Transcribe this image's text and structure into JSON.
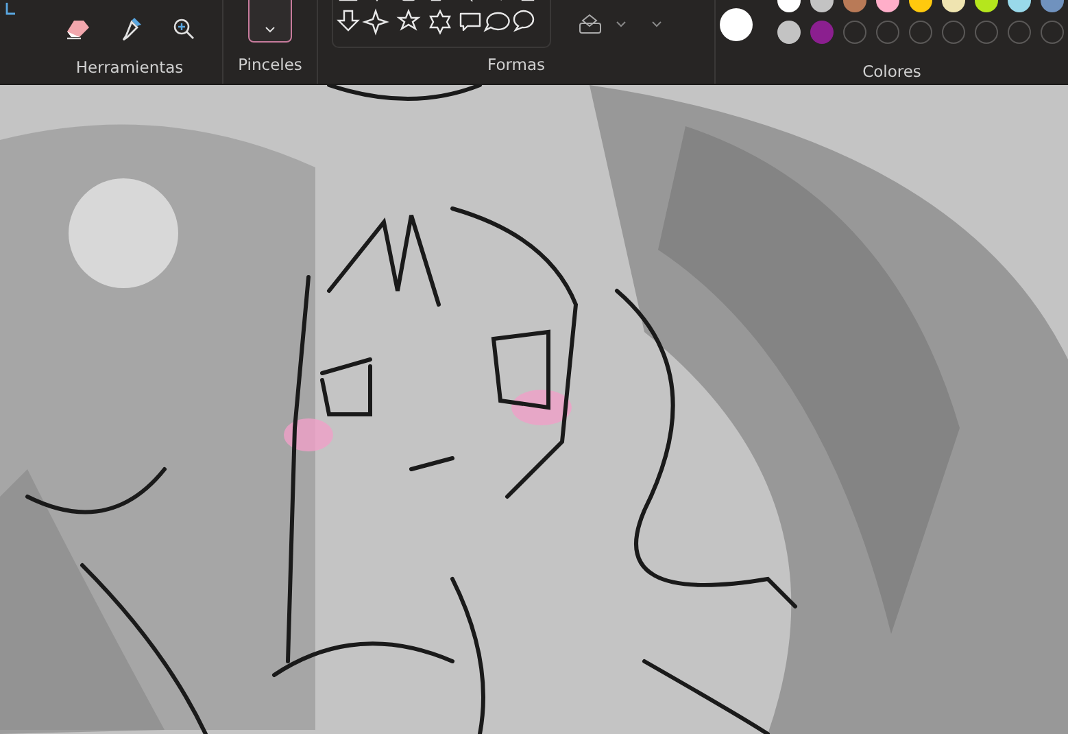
{
  "ribbon": {
    "tools": {
      "label": "Herramientas"
    },
    "brushes": {
      "label": "Pinceles"
    },
    "shapes": {
      "label": "Formas"
    },
    "colors": {
      "label": "Colores",
      "current_color": {
        "color": "#ffffff"
      },
      "top_row": [
        {
          "kind": "color",
          "color": "#ffffff"
        },
        {
          "kind": "color",
          "color": "#c3c3c3"
        },
        {
          "kind": "color",
          "color": "#b97a57"
        },
        {
          "kind": "color",
          "color": "#ffaec9"
        },
        {
          "kind": "color",
          "color": "#ffc90e"
        },
        {
          "kind": "color",
          "color": "#efe4b0"
        },
        {
          "kind": "color",
          "color": "#b5e61d"
        },
        {
          "kind": "color",
          "color": "#99d9ea"
        },
        {
          "kind": "color",
          "color": "#7092be"
        }
      ],
      "bottom_row": [
        {
          "kind": "color",
          "color": "#c3c3c3"
        },
        {
          "kind": "color",
          "color": "#8b1f8f"
        },
        {
          "kind": "empty"
        },
        {
          "kind": "empty"
        },
        {
          "kind": "empty"
        },
        {
          "kind": "empty"
        },
        {
          "kind": "empty"
        },
        {
          "kind": "empty"
        },
        {
          "kind": "empty"
        }
      ]
    }
  }
}
